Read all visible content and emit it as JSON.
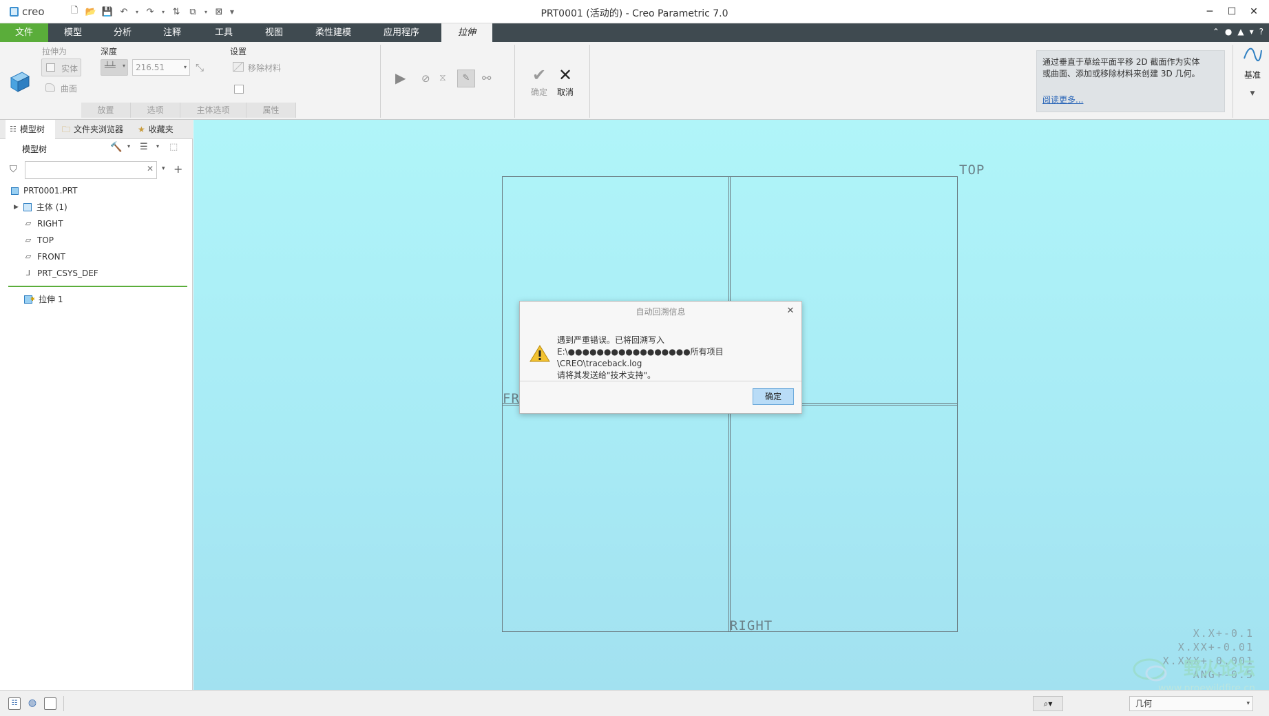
{
  "app": {
    "logo_text": "creo",
    "window_title": "PRT0001 (活动的) - Creo Parametric 7.0"
  },
  "tabs": [
    {
      "label": "文件"
    },
    {
      "label": "模型"
    },
    {
      "label": "分析"
    },
    {
      "label": "注释"
    },
    {
      "label": "工具"
    },
    {
      "label": "视图"
    },
    {
      "label": "柔性建模"
    },
    {
      "label": "应用程序"
    },
    {
      "label": "拉伸"
    }
  ],
  "ribbon": {
    "extrude_as_label": "拉伸为",
    "solid_label": "实体",
    "surface_label": "曲面",
    "depth_label": "深度",
    "depth_value": "216.51",
    "settings_label": "设置",
    "remove_material_label": "移除材料",
    "confirm_label": "确定",
    "cancel_label": "取消",
    "datum_label": "基准",
    "groups": [
      "放置",
      "选项",
      "主体选项",
      "属性"
    ],
    "help_text_line1": "通过垂直于草绘平面平移 2D 截面作为实体",
    "help_text_line2": "或曲面、添加或移除材料来创建 3D 几何。",
    "read_more": "阅读更多..."
  },
  "panel": {
    "tabs": [
      "模型树",
      "文件夹浏览器",
      "收藏夹"
    ],
    "tree_title": "模型树",
    "search_placeholder": "",
    "items": [
      {
        "label": "PRT0001.PRT"
      },
      {
        "label": "主体 (1)"
      },
      {
        "label": "RIGHT"
      },
      {
        "label": "TOP"
      },
      {
        "label": "FRONT"
      },
      {
        "label": "PRT_CSYS_DEF"
      },
      {
        "label": "拉伸 1"
      }
    ]
  },
  "graphics": {
    "plane_top": "TOP",
    "plane_front": "FR",
    "plane_right": "RIGHT",
    "tolerance": [
      "X.X+-0.1",
      "X.XX+-0.01",
      "X.XXX+-0.001",
      "ANG+-0.5"
    ],
    "watermark": "野火论坛",
    "watermark_url": "www.proewildfire.cn"
  },
  "dialog": {
    "title": "自动回溯信息",
    "line1": "遇到严重错误。已将回溯写入",
    "line2": "E:\\●●●●●●●●●●●●●●●●●所有项目\\CREO\\traceback.log",
    "line3": "请将其发送给\"技术支持\"。",
    "ok_label": "确定"
  },
  "status": {
    "filter_value": "几何"
  },
  "colors": {
    "file_tab": "#5aad3a",
    "tabbar": "#3f4a50",
    "graphics_bg": "#a8ebf5",
    "ok_button": "#b9dcf7"
  }
}
